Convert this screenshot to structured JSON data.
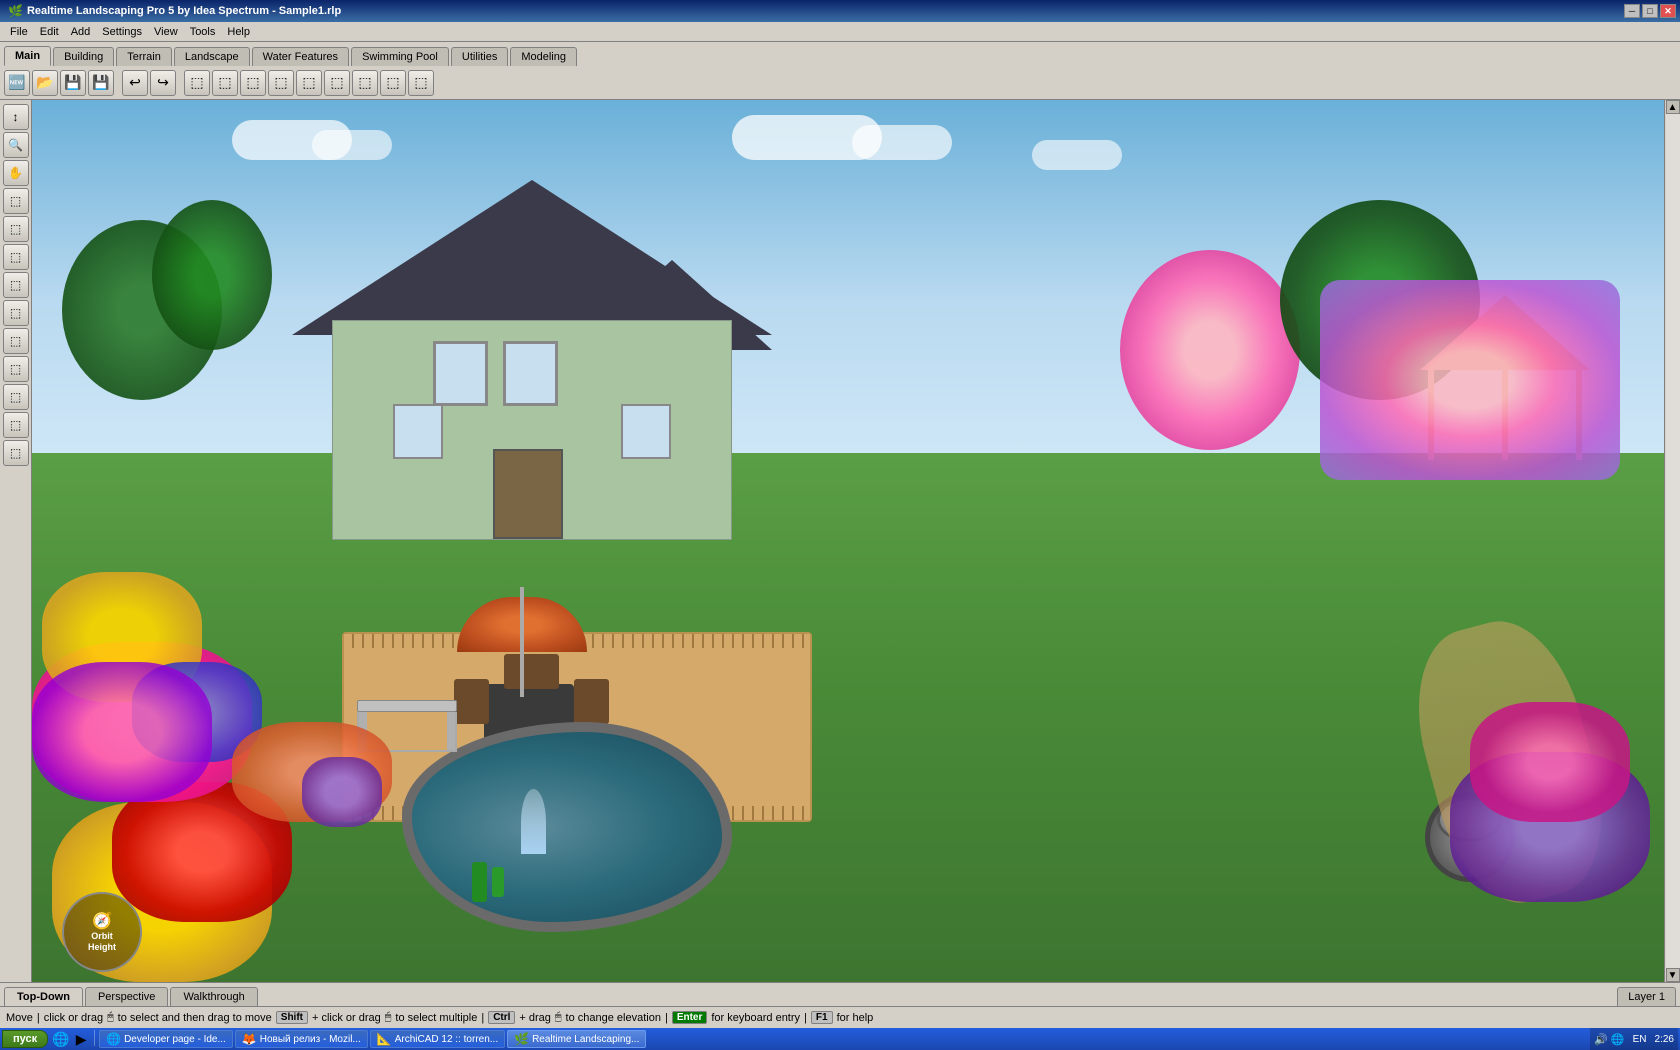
{
  "titlebar": {
    "title": "Realtime Landscaping Pro 5 by Idea Spectrum - Sample1.rlp",
    "min_btn": "─",
    "max_btn": "□",
    "close_btn": "✕"
  },
  "menubar": {
    "items": [
      "File",
      "Edit",
      "Add",
      "Settings",
      "View",
      "Tools",
      "Help"
    ]
  },
  "tabs": {
    "main": [
      "Main",
      "Building",
      "Terrain",
      "Landscape",
      "Water Features",
      "Swimming Pool",
      "Utilities",
      "Modeling"
    ]
  },
  "toolbar": {
    "buttons": [
      "🔄",
      "💾",
      "📂",
      "💾",
      "↩",
      "↪",
      "🖊",
      "✂",
      "📋",
      "📋",
      "⬚",
      "⬚",
      "⬚",
      "⬚",
      "⬚"
    ]
  },
  "sidebar": {
    "buttons": [
      "↕",
      "🔍",
      "🖱",
      "⬚",
      "⬚",
      "⬚",
      "⬚",
      "⬚",
      "⬚",
      "⬚",
      "⬚",
      "⬚",
      "⬚"
    ]
  },
  "scene": {
    "description": "3D landscape scene with house, deck, garden, pond"
  },
  "compass": {
    "orbit_label": "Orbit",
    "height_label": "Height"
  },
  "bottom_tabs": {
    "items": [
      "Top-Down",
      "Perspective",
      "Walkthrough"
    ],
    "active": "Top-Down",
    "layer_label": "Layer 1"
  },
  "statusbar": {
    "action": "Move",
    "instructions": [
      {
        "label": null,
        "text": "click or drag"
      },
      {
        "label": null,
        "text": "to select and then drag to move"
      },
      {
        "label": "Shift",
        "text": "click or drag"
      },
      {
        "label": null,
        "text": "to select multiple"
      },
      {
        "label": "Ctrl",
        "text": "drag"
      },
      {
        "label": null,
        "text": "to change elevation"
      },
      {
        "label": "Enter",
        "text": "for keyboard entry"
      },
      {
        "label": "F1",
        "text": "for help"
      }
    ]
  },
  "taskbar": {
    "start_label": "пуск",
    "items": [
      {
        "label": "Developer page - Ide...",
        "active": false
      },
      {
        "label": "Новый релиз - Mozil...",
        "active": false
      },
      {
        "label": "ArchiCAD 12 :: torren...",
        "active": false
      },
      {
        "label": "Realtime Landscaping...",
        "active": true
      }
    ],
    "tray": {
      "lang": "EN",
      "time": "2:26"
    }
  }
}
